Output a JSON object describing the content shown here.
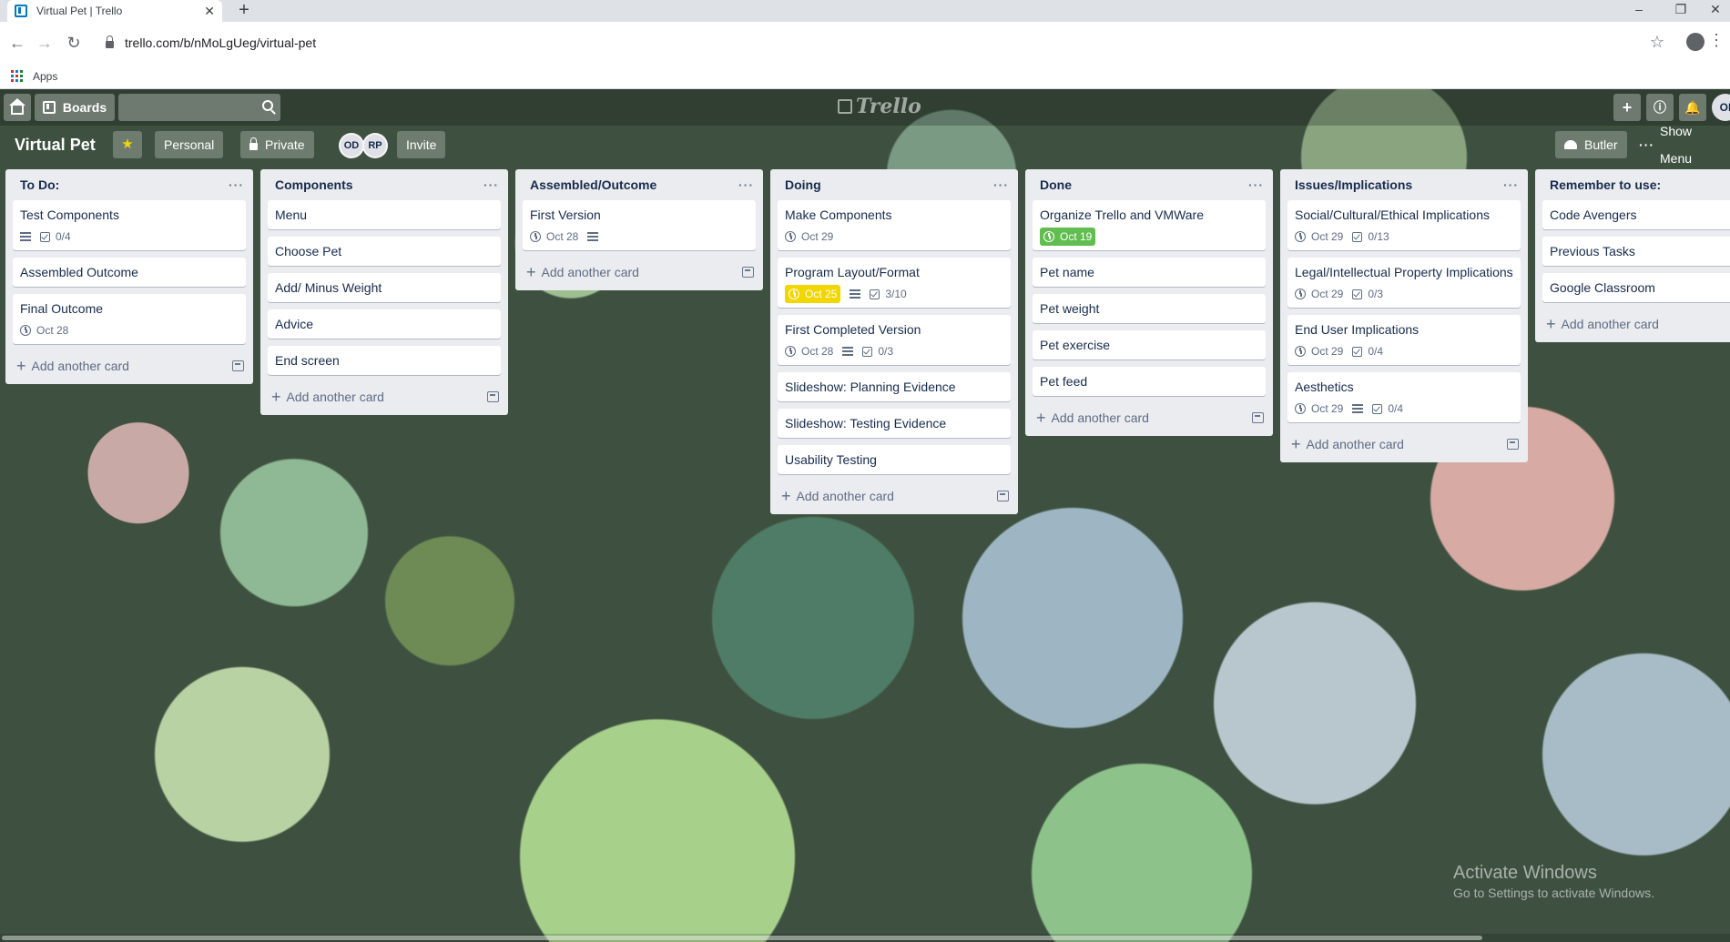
{
  "browser": {
    "tab_title": "Virtual Pet | Trello",
    "tab_close": "✕",
    "new_tab": "+",
    "url": "trello.com/b/nMoLgUeg/virtual-pet",
    "bookmarks_apps": "Apps",
    "win_minimize": "–",
    "win_restore": "❐",
    "win_close": "✕"
  },
  "topbar": {
    "boards_label": "Boards",
    "logo": "Trello",
    "user_initials": "OI"
  },
  "board": {
    "title": "Virtual Pet",
    "star": "★",
    "team": "Personal",
    "visibility": "Private",
    "members": [
      "OD",
      "RP"
    ],
    "invite": "Invite",
    "butler": "Butler",
    "show_menu": "Show Menu",
    "show_menu_dots": "···"
  },
  "lists": [
    {
      "title": "To Do:",
      "menu": "···",
      "add_label": "Add another card",
      "cards": [
        {
          "title": "Test Components",
          "badges": {
            "desc": true,
            "checklist": "0/4"
          }
        },
        {
          "title": "Assembled Outcome"
        },
        {
          "title": "Final Outcome",
          "badges": {
            "due": "Oct 28"
          }
        }
      ]
    },
    {
      "title": "Components",
      "menu": "···",
      "add_label": "Add another card",
      "cards": [
        {
          "title": "Menu"
        },
        {
          "title": "Choose Pet"
        },
        {
          "title": "Add/ Minus Weight"
        },
        {
          "title": "Advice"
        },
        {
          "title": "End screen"
        }
      ]
    },
    {
      "title": "Assembled/Outcome",
      "menu": "···",
      "add_label": "Add another card",
      "cards": [
        {
          "title": "First Version",
          "badges": {
            "due": "Oct 28",
            "desc": true
          }
        }
      ]
    },
    {
      "title": "Doing",
      "menu": "···",
      "add_label": "Add another card",
      "cards": [
        {
          "title": "Make Components",
          "badges": {
            "due": "Oct 29"
          }
        },
        {
          "title": "Program Layout/Format",
          "badges": {
            "due": "Oct 25",
            "due_status": "yellow",
            "desc": true,
            "checklist": "3/10"
          }
        },
        {
          "title": "First Completed Version",
          "badges": {
            "due": "Oct 28",
            "desc": true,
            "checklist": "0/3"
          }
        },
        {
          "title": "Slideshow: Planning Evidence"
        },
        {
          "title": "Slideshow: Testing Evidence"
        },
        {
          "title": "Usability Testing"
        }
      ]
    },
    {
      "title": "Done",
      "menu": "···",
      "add_label": "Add another card",
      "cards": [
        {
          "title": "Organize Trello and VMWare",
          "badges": {
            "due": "Oct 19",
            "due_status": "green"
          }
        },
        {
          "title": "Pet name"
        },
        {
          "title": "Pet weight"
        },
        {
          "title": "Pet exercise"
        },
        {
          "title": "Pet feed"
        }
      ]
    },
    {
      "title": "Issues/Implications",
      "menu": "···",
      "add_label": "Add another card",
      "cards": [
        {
          "title": "Social/Cultural/Ethical Implications",
          "badges": {
            "due": "Oct 29",
            "checklist": "0/13"
          }
        },
        {
          "title": "Legal/Intellectual Property Implications",
          "badges": {
            "due": "Oct 29",
            "checklist": "0/3"
          }
        },
        {
          "title": "End User Implications",
          "badges": {
            "due": "Oct 29",
            "checklist": "0/4"
          }
        },
        {
          "title": "Aesthetics",
          "badges": {
            "due": "Oct 29",
            "desc": true,
            "checklist": "0/4"
          }
        }
      ]
    },
    {
      "title": "Remember to use:",
      "menu": "",
      "add_label": "Add another card",
      "cards": [
        {
          "title": "Code Avengers"
        },
        {
          "title": "Previous Tasks"
        },
        {
          "title": "Google Classroom"
        }
      ]
    }
  ],
  "watermark": {
    "line1": "Activate Windows",
    "line2": "Go to Settings to activate Windows."
  },
  "colors": {
    "due_green": "#61bd4f",
    "due_yellow": "#f2d600",
    "list_bg": "#ebecf0"
  }
}
